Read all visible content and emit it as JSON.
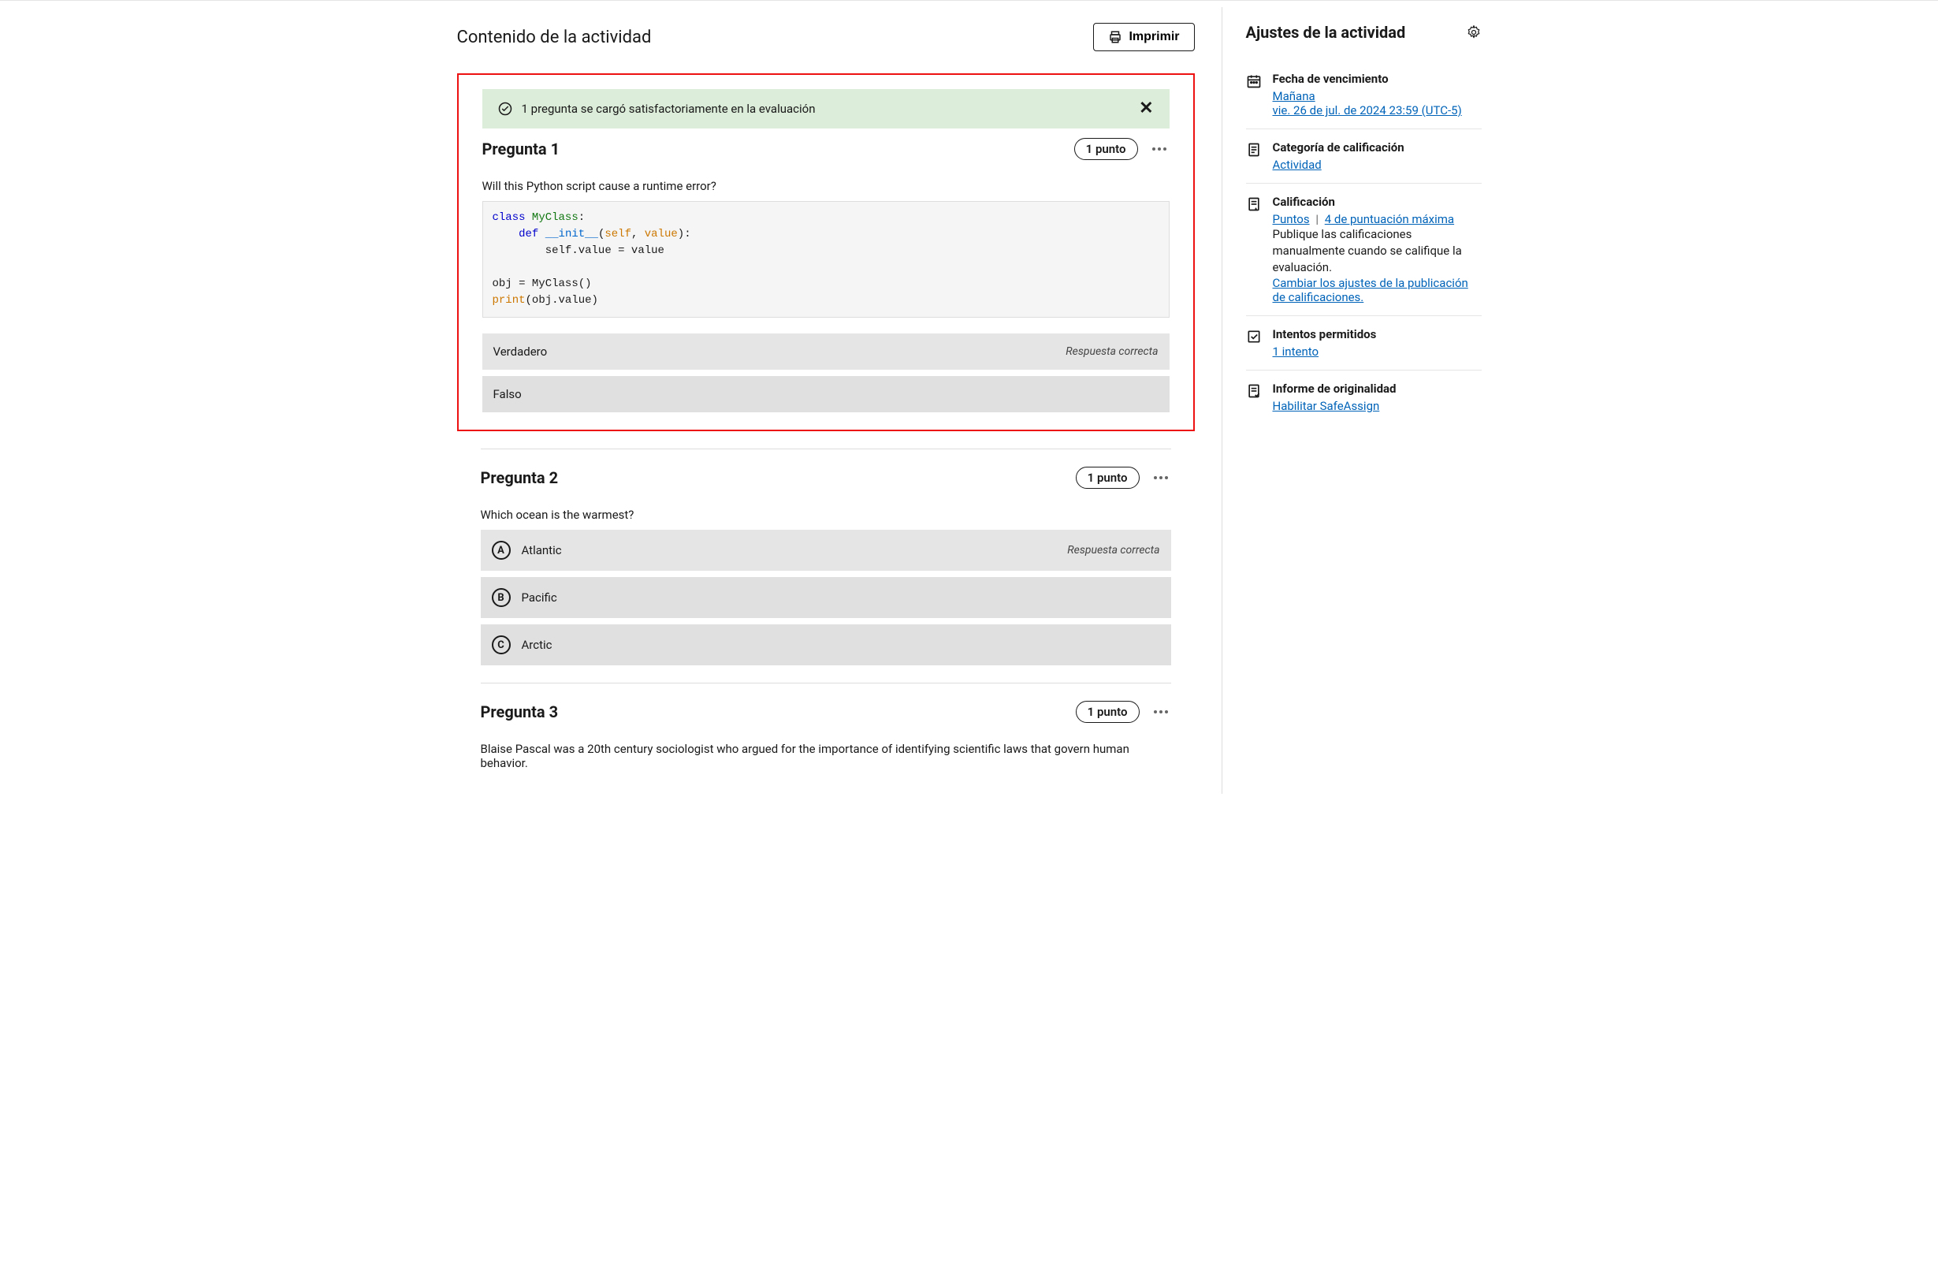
{
  "header": {
    "title": "Contenido de la actividad",
    "print_label": "Imprimir"
  },
  "banner": {
    "text": "1 pregunta se cargó satisfactoriamente en la evaluación"
  },
  "questions": [
    {
      "title": "Pregunta 1",
      "points": "1 punto",
      "prompt": "Will this Python script cause a runtime error?",
      "answers": [
        {
          "label": "Verdadero",
          "correct_text": "Respuesta correcta"
        },
        {
          "label": "Falso"
        }
      ]
    },
    {
      "title": "Pregunta 2",
      "points": "1 punto",
      "prompt": "Which ocean is the warmest?",
      "options": [
        {
          "letter": "A",
          "label": "Atlantic",
          "correct_text": "Respuesta correcta"
        },
        {
          "letter": "B",
          "label": "Pacific"
        },
        {
          "letter": "C",
          "label": "Arctic"
        }
      ]
    },
    {
      "title": "Pregunta 3",
      "points": "1 punto",
      "prompt": "Blaise Pascal was a 20th century sociologist who argued for the importance of identifying scientific laws that govern human behavior."
    }
  ],
  "sidebar": {
    "title": "Ajustes de la actividad",
    "due": {
      "label": "Fecha de vencimiento",
      "link1": "Mañana",
      "link2": "vie. 26 de jul. de 2024 23:59 (UTC-5)"
    },
    "category": {
      "label": "Categoría de calificación",
      "link": "Actividad"
    },
    "grading": {
      "label": "Calificación",
      "link1": "Puntos",
      "sep": "|",
      "link2": "4 de puntuación máxima",
      "text": "Publique las calificaciones manualmente cuando se califique la evaluación.",
      "link3": "Cambiar los ajustes de la publicación de calificaciones."
    },
    "attempts": {
      "label": "Intentos permitidos",
      "link": "1 intento"
    },
    "originality": {
      "label": "Informe de originalidad",
      "link": "Habilitar SafeAssign"
    }
  }
}
